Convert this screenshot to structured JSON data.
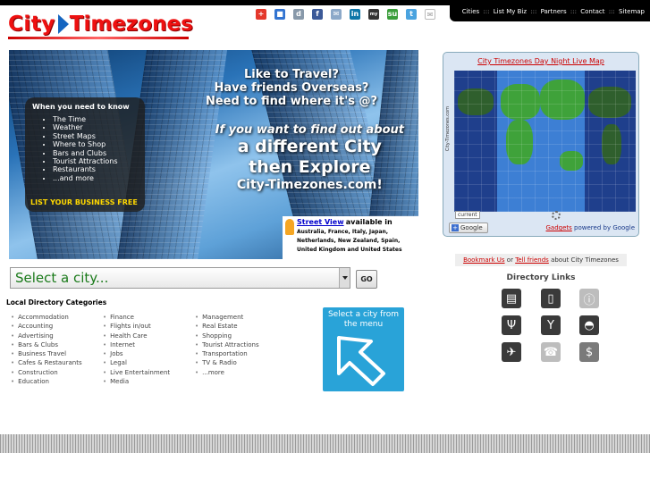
{
  "header": {
    "logo_word1": "City",
    "logo_word2": "Timezones",
    "top_links": [
      "Cities",
      "List My Biz",
      "Partners",
      "Contact",
      "Sitemap"
    ],
    "top_sep": ":::",
    "social_icons": [
      "addthis-icon",
      "delicious-icon",
      "digg-icon",
      "facebook-icon",
      "email-icon",
      "linkedin-icon",
      "myspace-icon",
      "stumbleupon-icon",
      "twitter-icon",
      "mail-icon"
    ]
  },
  "banner": {
    "headline": [
      "Like to Travel?",
      "Have friends Overseas?",
      "Need to find where it's @?"
    ],
    "headline2": [
      "If you want to find out about",
      "a different City",
      "then Explore",
      "City-Timezones.com!"
    ],
    "when_title": "When you need to know",
    "when_items": [
      "The Time",
      "Weather",
      "Street Maps",
      "Where to Shop",
      "Bars and Clubs",
      "Tourist Attractions",
      "Restaurants",
      "...and more"
    ],
    "cta": "LIST YOUR BUSINESS FREE",
    "street_view_link": "Street View",
    "street_view_avail": "available in",
    "street_view_countries": "Australia, France, Italy, Japan, Netherlands, New Zealand, Spain, United Kingdom and United States"
  },
  "city_select": {
    "placeholder": "Select a city...",
    "go_label": "GO"
  },
  "local_directory": {
    "title": "Local Directory Categories",
    "col1": [
      "Accommodation",
      "Accounting",
      "Advertising",
      "Bars & Clubs",
      "Business Travel",
      "Cafes & Restaurants",
      "Construction",
      "Education"
    ],
    "col2": [
      "Finance",
      "Flights in/out",
      "Health Care",
      "Internet",
      "Jobs",
      "Legal",
      "Live Entertainment",
      "Media"
    ],
    "col3": [
      "Management",
      "Real Estate",
      "Shopping",
      "Tourist Attractions",
      "Transportation",
      "TV & Radio",
      "...more"
    ]
  },
  "select_box": {
    "text": "Select a city from the menu"
  },
  "map_panel": {
    "title": "City Timezones Day Night Live Map",
    "vertical_text": "City-Timezones.com",
    "current_label": "current",
    "google_btn": "Google",
    "gadgets_link": "Gadgets",
    "powered_by": "powered by Google"
  },
  "bookmark": {
    "link1": "Bookmark Us",
    "or": "or",
    "link2": "Tell friends",
    "suffix": "about City Timezones"
  },
  "directory_links": {
    "title": "Directory Links",
    "icons": [
      "shop-icon",
      "phone-icon",
      "info-icon",
      "restaurant-icon",
      "cocktail-icon",
      "car-icon",
      "airplane-icon",
      "phone-handset-icon",
      "dollar-icon"
    ],
    "colors": [
      "#3a3a3a",
      "#3a3a3a",
      "#bdbdbd",
      "#3a3a3a",
      "#3a3a3a",
      "#3a3a3a",
      "#3a3a3a",
      "#bdbdbd",
      "#7a7a7a"
    ]
  }
}
